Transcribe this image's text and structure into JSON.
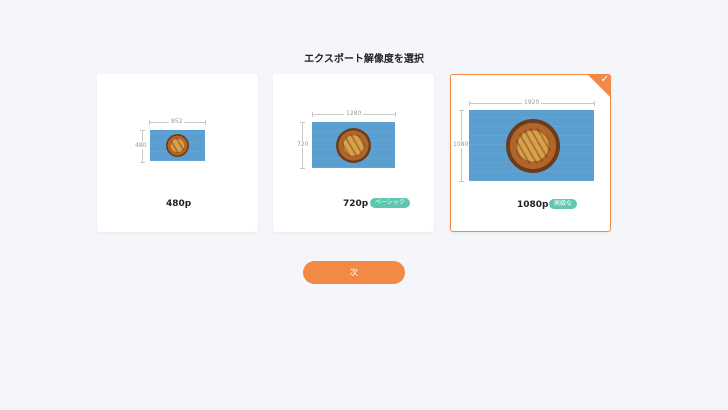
{
  "title": "エクスポート解像度を選択",
  "colors": {
    "accent": "#f28a45",
    "badge": "#5fc7b0",
    "photo_bg": "#5b9ed0"
  },
  "options": [
    {
      "label": "480p",
      "width": "852",
      "height": "480",
      "badge": "",
      "selected": false
    },
    {
      "label": "720p",
      "width": "1280",
      "height": "720",
      "badge": "ベーシック",
      "selected": false
    },
    {
      "label": "1080p",
      "width": "1920",
      "height": "1080",
      "badge": "高級な",
      "selected": true
    }
  ],
  "selected_icon": "checkmark-icon",
  "next_button": {
    "label": "次"
  }
}
